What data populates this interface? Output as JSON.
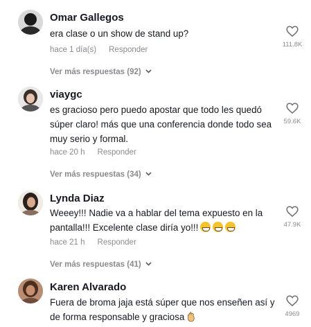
{
  "comments": [
    {
      "user": "Omar Gallegos",
      "text": "era clase o un show de stand up?",
      "time": "hace 1 día(s)",
      "reply_label": "Responder",
      "more_label": "Ver más respuestas (92)",
      "likes": "111.8K"
    },
    {
      "user": "viaygc",
      "text": "es gracioso pero puedo apostar que todo les quedó súper claro! más que una conferencia donde todo sea muy serio y formal.",
      "time": "hace 20 h",
      "reply_label": "Responder",
      "more_label": "Ver más respuestas (34)",
      "likes": "59.6K"
    },
    {
      "user": "Lynda Diaz",
      "text": "Weeey!!! Nadie va a hablar del tema expuesto en la pantalla!!! Excelente clase diría yo!!!",
      "time": "hace 21 h",
      "reply_label": "Responder",
      "more_label": "Ver más respuestas (41)",
      "likes": "47.9K"
    },
    {
      "user": "Karen Alvarado",
      "text": "Fuera de broma jaja está súper que nos enseñen así y de forma responsable y graciosa",
      "likes": "4969"
    }
  ]
}
